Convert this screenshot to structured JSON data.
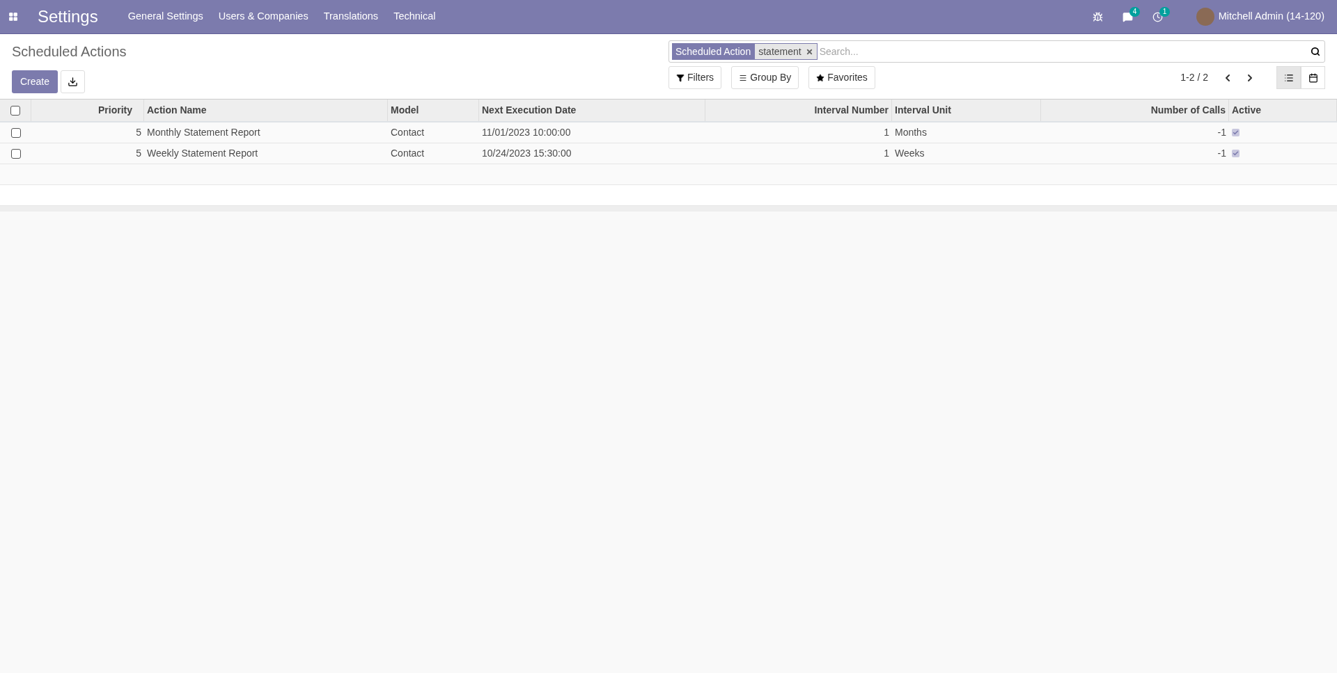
{
  "navbar": {
    "app_title": "Settings",
    "menu": [
      "General Settings",
      "Users & Companies",
      "Translations",
      "Technical"
    ],
    "messages_badge": "4",
    "activities_badge": "1",
    "user_name": "Mitchell Admin (14-120)"
  },
  "control_panel": {
    "title": "Scheduled Actions",
    "create_button": "Create",
    "search": {
      "facet_label": "Scheduled Action",
      "facet_value": "statement",
      "placeholder": "Search..."
    },
    "filter_buttons": [
      "Filters",
      "Group By",
      "Favorites"
    ],
    "pager": "1-2 / 2",
    "views": [
      {
        "kind": "list",
        "selected": true
      },
      {
        "kind": "calendar",
        "selected": false
      }
    ]
  },
  "table": {
    "select_all_checked": false,
    "columns": [
      {
        "label": "Priority",
        "kind": "number"
      },
      {
        "label": "Action Name",
        "kind": "text"
      },
      {
        "label": "Model",
        "kind": "text"
      },
      {
        "label": "Next Execution Date",
        "kind": "text"
      },
      {
        "label": "Interval Number",
        "kind": "number"
      },
      {
        "label": "Interval Unit",
        "kind": "text"
      },
      {
        "label": "Number of Calls",
        "kind": "number"
      },
      {
        "label": "Active",
        "kind": "text"
      }
    ],
    "rows": [
      {
        "cells": [
          "5",
          "Monthly Statement Report",
          "Contact",
          "11/01/2023 10:00:00",
          "1",
          "Months",
          "-1"
        ],
        "active": true,
        "selected": false
      },
      {
        "cells": [
          "5",
          "Weekly Statement Report",
          "Contact",
          "10/24/2023 15:30:00",
          "1",
          "Weeks",
          "-1"
        ],
        "active": true,
        "selected": false
      }
    ]
  }
}
